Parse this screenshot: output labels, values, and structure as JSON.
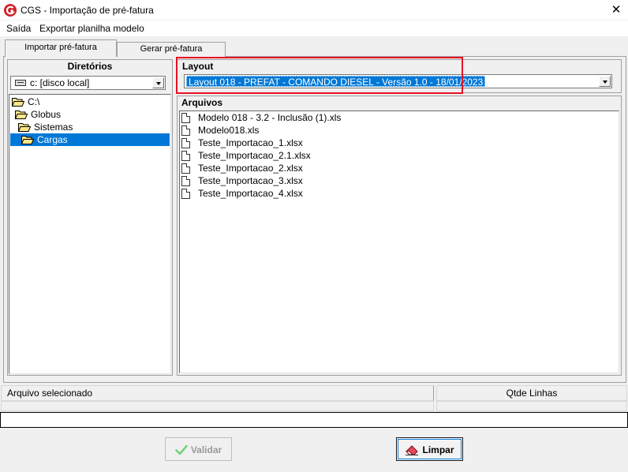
{
  "window": {
    "title": "CGS - Importação de pré-fatura",
    "close_label": "✕"
  },
  "menu": {
    "items": [
      {
        "label": "Saída"
      },
      {
        "label": "Exportar planilha modelo"
      }
    ]
  },
  "tabs": [
    {
      "label": "Importar pré-fatura",
      "active": true
    },
    {
      "label": "Gerar pré-fatura",
      "active": false
    }
  ],
  "directories": {
    "header": "Diretórios",
    "drive": {
      "value": "c: [disco local]",
      "icon": "drive-icon"
    },
    "tree": [
      {
        "label": "C:\\",
        "level": 0,
        "icon": "folder-open-icon",
        "selected": false
      },
      {
        "label": "Globus",
        "level": 1,
        "icon": "folder-open-icon",
        "selected": false
      },
      {
        "label": "Sistemas",
        "level": 2,
        "icon": "folder-open-icon",
        "selected": false
      },
      {
        "label": "Cargas",
        "level": 3,
        "icon": "folder-open-icon",
        "selected": true
      }
    ]
  },
  "layout": {
    "header": "Layout",
    "selected": "Layout 018 - PREFAT - COMANDO DIESEL - Versão 1.0 - 18/01/2023",
    "highlight_color": "#e81123"
  },
  "files": {
    "header": "Arquivos",
    "items": [
      {
        "name": "Modelo 018 - 3.2 - Inclusão (1).xls",
        "icon": "document-icon"
      },
      {
        "name": "Modelo018.xls",
        "icon": "document-icon"
      },
      {
        "name": "Teste_Importacao_1.xlsx",
        "icon": "document-icon"
      },
      {
        "name": "Teste_Importacao_2.1.xlsx",
        "icon": "document-icon"
      },
      {
        "name": "Teste_Importacao_2.xlsx",
        "icon": "document-icon"
      },
      {
        "name": "Teste_Importacao_3.xlsx",
        "icon": "document-icon"
      },
      {
        "name": "Teste_Importacao_4.xlsx",
        "icon": "document-icon"
      }
    ]
  },
  "status": {
    "selected_file_label": "Arquivo selecionado",
    "row_count_label": "Qtde Linhas",
    "selected_file_value": "",
    "row_count_value": "",
    "path_value": ""
  },
  "buttons": {
    "validate": {
      "label": "Validar",
      "enabled": false,
      "icon": "check-icon"
    },
    "clear": {
      "label": "Limpar",
      "enabled": true,
      "icon": "eraser-icon"
    }
  },
  "colors": {
    "accent": "#0078d7",
    "highlight": "#e81123"
  }
}
